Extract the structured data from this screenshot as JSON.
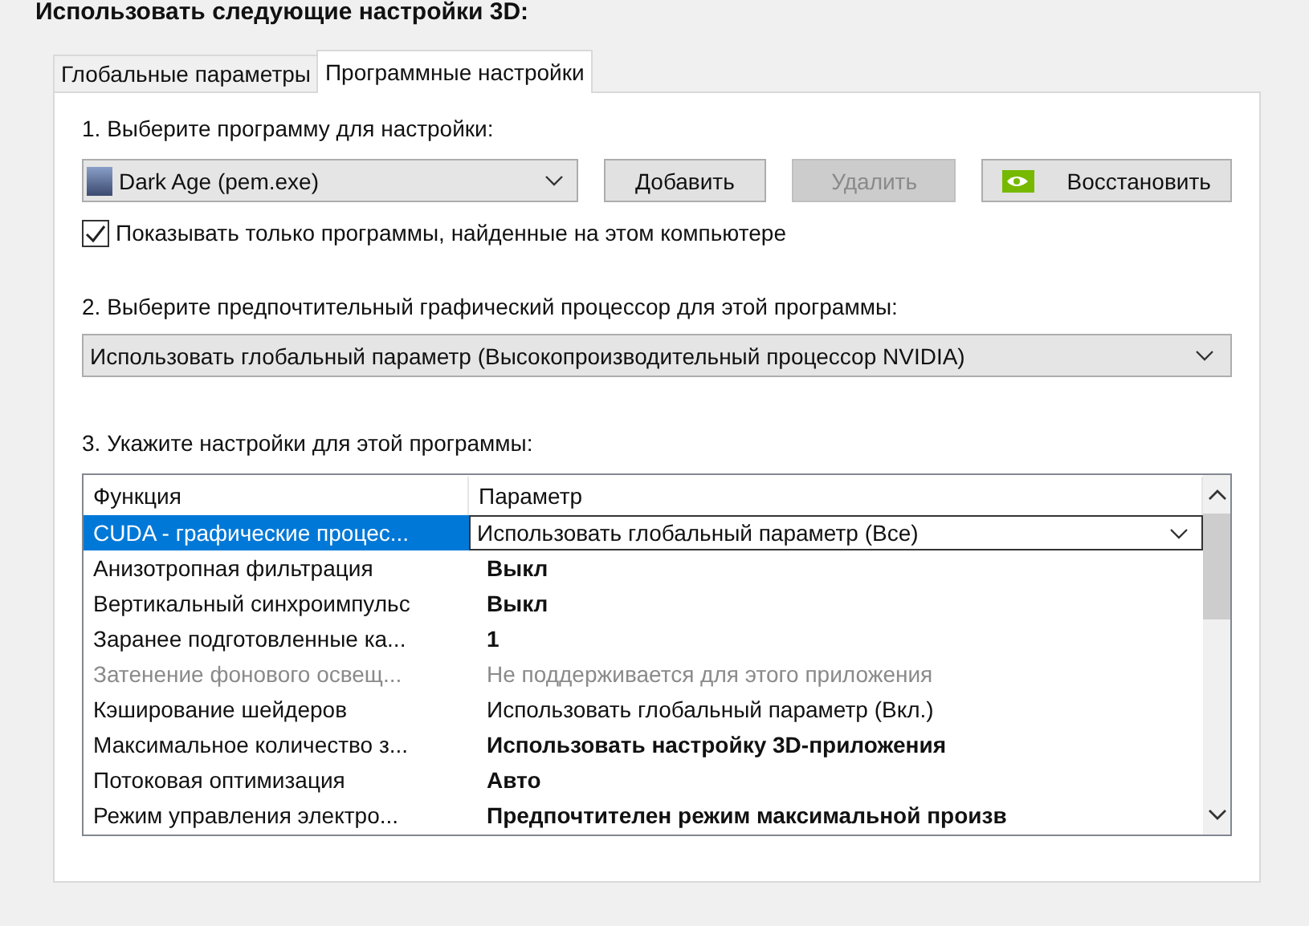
{
  "heading": "Использовать следующие настройки 3D:",
  "tabs": [
    {
      "label": "Глобальные параметры",
      "selected": false
    },
    {
      "label": "Программные настройки",
      "selected": true
    }
  ],
  "step1": {
    "label": "1. Выберите программу для настройки:",
    "program": "Dark Age (pem.exe)",
    "buttons": [
      {
        "label": "Добавить",
        "disabled": false
      },
      {
        "label": "Удалить",
        "disabled": true
      },
      {
        "label": "Восстановить",
        "disabled": false,
        "kind": "restore"
      }
    ],
    "checkbox": {
      "label": "Показывать только программы, найденные на этом компьютере",
      "checked": true
    }
  },
  "step2": {
    "label": "2. Выберите предпочтительный графический процессор для этой программы:",
    "value": "Использовать глобальный параметр (Высокопроизводительный процессор NVIDIA)"
  },
  "step3": {
    "label": "3. Укажите настройки для этой программы:",
    "columns": [
      "Функция",
      "Параметр"
    ],
    "rows": [
      {
        "function": "CUDA - графические процес...",
        "value": "Использовать глобальный параметр (Все)",
        "selected": true,
        "bold": false,
        "disabled": false
      },
      {
        "function": "Анизотропная фильтрация",
        "value": "Выкл",
        "selected": false,
        "bold": true,
        "disabled": false
      },
      {
        "function": "Вертикальный синхроимпульс",
        "value": "Выкл",
        "selected": false,
        "bold": true,
        "disabled": false
      },
      {
        "function": "Заранее подготовленные ка...",
        "value": "1",
        "selected": false,
        "bold": true,
        "disabled": false
      },
      {
        "function": "Затенение фонового освещ...",
        "value": "Не поддерживается для этого приложения",
        "selected": false,
        "bold": false,
        "disabled": true
      },
      {
        "function": "Кэширование шейдеров",
        "value": "Использовать глобальный параметр (Вкл.)",
        "selected": false,
        "bold": false,
        "disabled": false
      },
      {
        "function": "Максимальное количество з...",
        "value": "Использовать настройку 3D-приложения",
        "selected": false,
        "bold": true,
        "disabled": false
      },
      {
        "function": "Потоковая оптимизация",
        "value": "Авто",
        "selected": false,
        "bold": true,
        "disabled": false
      },
      {
        "function": "Режим управления электро...",
        "value": "Предпочтителен режим максимальной произв",
        "selected": false,
        "bold": true,
        "disabled": false
      }
    ]
  }
}
